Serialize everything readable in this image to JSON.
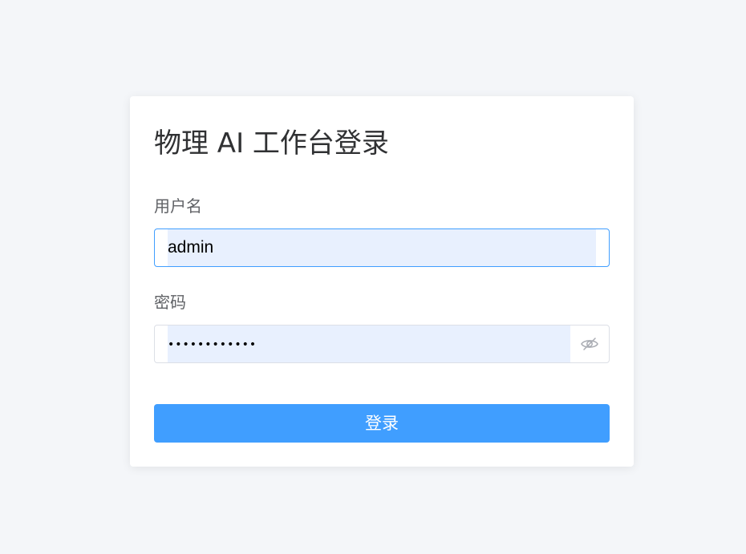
{
  "login": {
    "title": "物理 AI 工作台登录",
    "username_label": "用户名",
    "username_value": "admin",
    "password_label": "密码",
    "password_masked": "••••••••••••",
    "submit_label": "登录"
  },
  "icons": {
    "password_toggle": "eye-hidden-icon"
  },
  "colors": {
    "primary": "#409eff",
    "background": "#f4f6f9",
    "autofill": "#e8f0fe",
    "input_border": "#dcdfe6",
    "title_text": "#303133",
    "label_text": "#606266"
  }
}
